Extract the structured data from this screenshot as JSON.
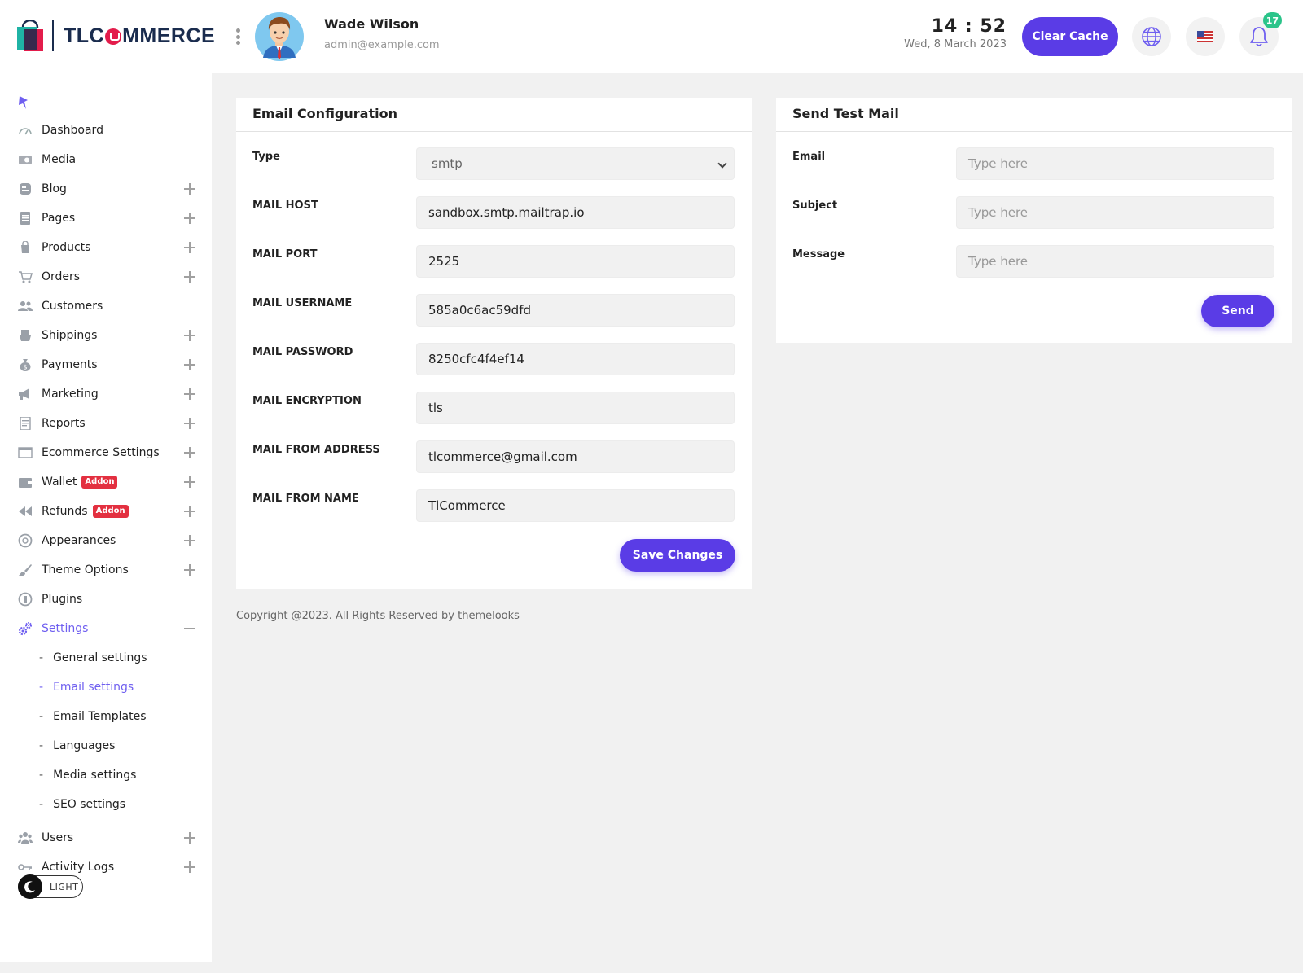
{
  "header": {
    "logo_text_before": "TLC",
    "logo_text_after": "MMERCE",
    "user_name": "Wade Wilson",
    "user_email": "admin@example.com",
    "time": "14 : 52",
    "date": "Wed, 8 March 2023",
    "clear_cache_label": "Clear Cache",
    "notification_count": "17"
  },
  "sidebar": {
    "items": [
      {
        "label": "Dashboard"
      },
      {
        "label": "Media"
      },
      {
        "label": "Blog"
      },
      {
        "label": "Pages"
      },
      {
        "label": "Products"
      },
      {
        "label": "Orders"
      },
      {
        "label": "Customers"
      },
      {
        "label": "Shippings"
      },
      {
        "label": "Payments"
      },
      {
        "label": "Marketing"
      },
      {
        "label": "Reports"
      },
      {
        "label": "Ecommerce Settings"
      },
      {
        "label": "Wallet",
        "badge": "Addon"
      },
      {
        "label": "Refunds",
        "badge": "Addon"
      },
      {
        "label": "Appearances"
      },
      {
        "label": "Theme Options"
      },
      {
        "label": "Plugins"
      },
      {
        "label": "Settings"
      },
      {
        "label": "Users"
      },
      {
        "label": "Activity Logs"
      }
    ],
    "settings_sub": [
      {
        "label": "General settings"
      },
      {
        "label": "Email settings"
      },
      {
        "label": "Email Templates"
      },
      {
        "label": "Languages"
      },
      {
        "label": "Media settings"
      },
      {
        "label": "SEO settings"
      }
    ],
    "sub_dash": "-",
    "theme_toggle_label": "LIGHT"
  },
  "email_config": {
    "title": "Email Configuration",
    "fields": [
      {
        "label": "Type",
        "value": "smtp"
      },
      {
        "label": "MAIL HOST",
        "value": "sandbox.smtp.mailtrap.io"
      },
      {
        "label": "MAIL PORT",
        "value": "2525"
      },
      {
        "label": "MAIL USERNAME",
        "value": "585a0c6ac59dfd"
      },
      {
        "label": "MAIL PASSWORD",
        "value": "8250cfc4f4ef14"
      },
      {
        "label": "MAIL ENCRYPTION",
        "value": "tls"
      },
      {
        "label": "MAIL FROM ADDRESS",
        "value": "tlcommerce@gmail.com"
      },
      {
        "label": "MAIL FROM NAME",
        "value": "TlCommerce"
      }
    ],
    "save_label": "Save Changes"
  },
  "test_mail": {
    "title": "Send Test Mail",
    "fields": [
      {
        "label": "Email",
        "placeholder": "Type here"
      },
      {
        "label": "Subject",
        "placeholder": "Type here"
      },
      {
        "label": "Message",
        "placeholder": "Type here"
      }
    ],
    "send_label": "Send"
  },
  "footer": {
    "copyright": "Copyright @2023. All Rights Reserved by themelooks"
  },
  "colors": {
    "primary": "#5a3ce6",
    "active_nav": "#6f5ff0",
    "addon_badge": "#e33040",
    "notif_badge": "#2bc48a",
    "brand_navy": "#1a2c4e",
    "brand_red": "#e31c4b"
  }
}
